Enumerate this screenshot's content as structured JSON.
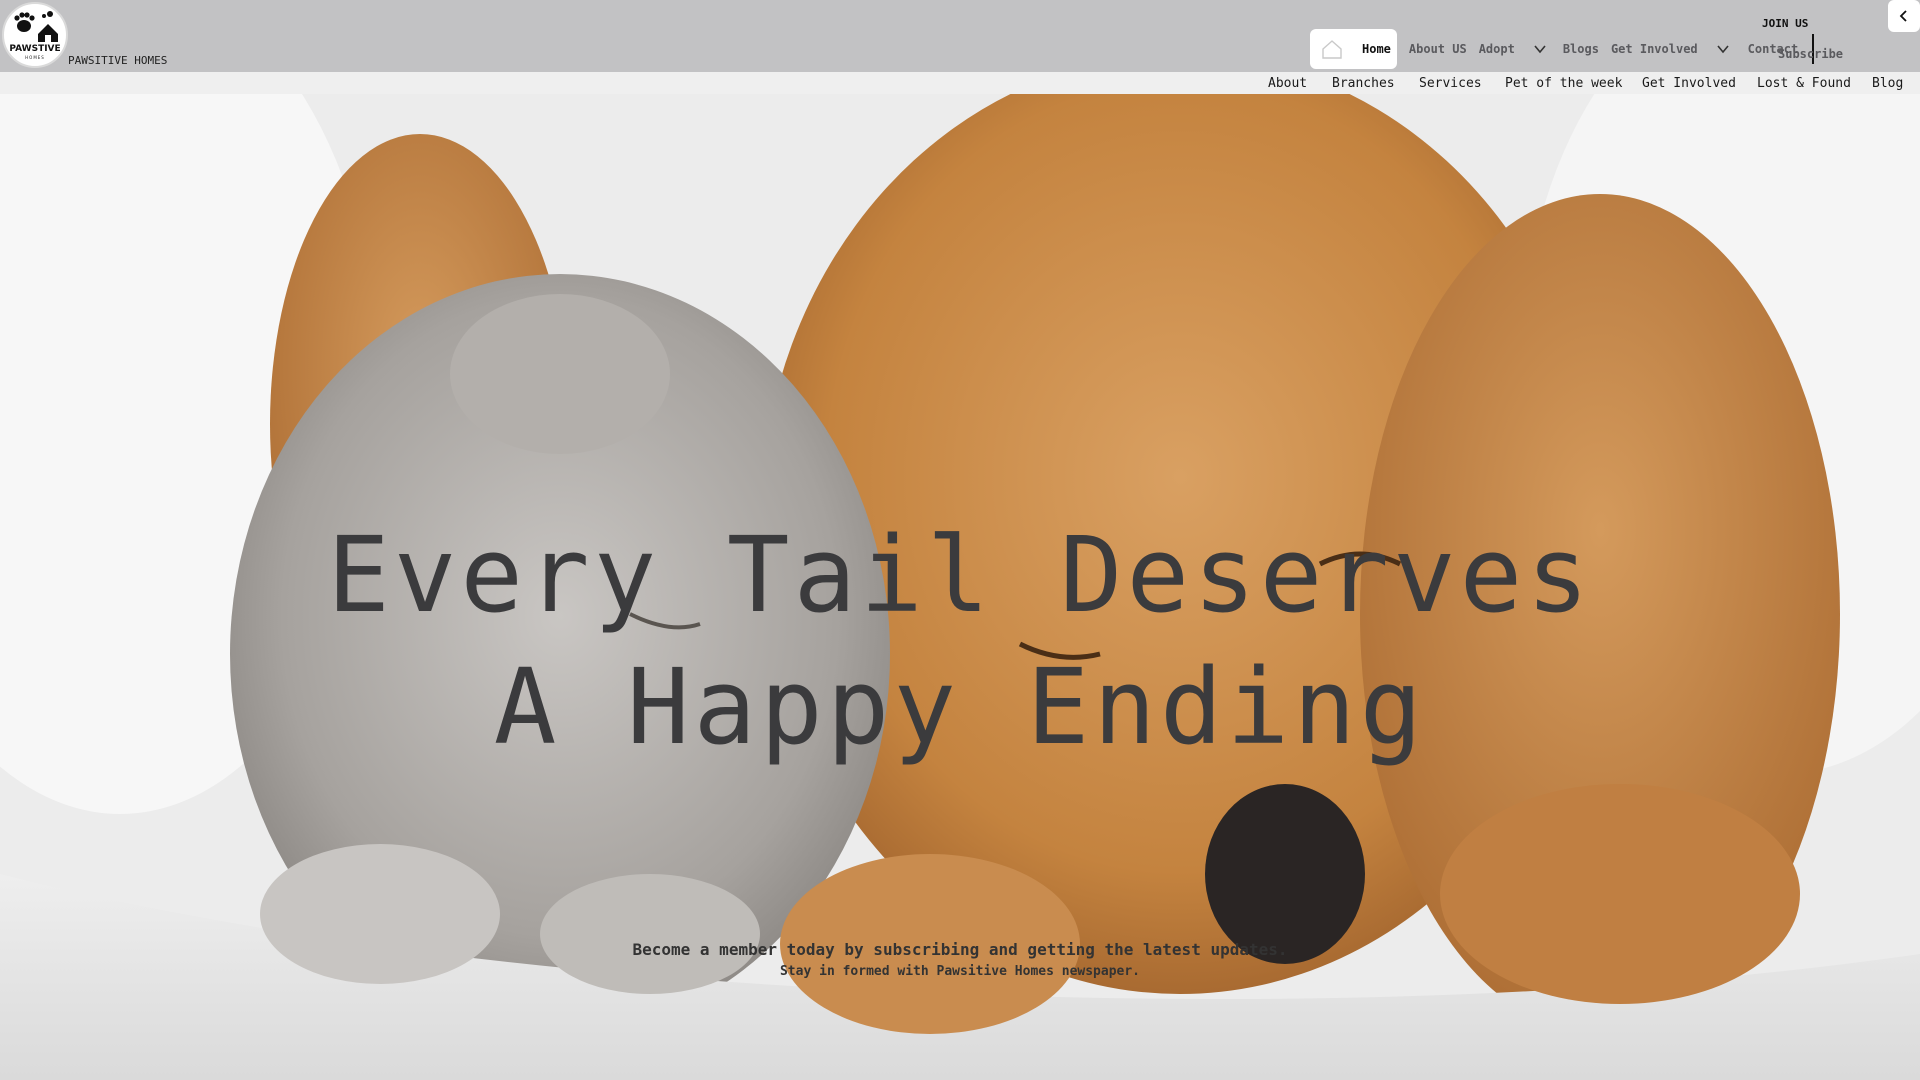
{
  "brand": {
    "logo_text": "PAWSTIVE",
    "logo_subtext": "HOMES",
    "name": "PAWSITIVE HOMES"
  },
  "nav": {
    "home": "Home",
    "about": "About US",
    "adopt": "Adopt",
    "blogs": "Blogs",
    "get_involved": "Get Involved",
    "contact": "Contact",
    "join_us": "JOIN US",
    "subscribe": "Subscribe"
  },
  "subnav": {
    "items": [
      "About",
      "Branches",
      "Services",
      "Pet of the week",
      "Get Involved",
      "Lost & Found",
      "Blog"
    ]
  },
  "hero": {
    "headline_line1": "Every Tail Deserves",
    "headline_line2": "A Happy Ending",
    "subtitle1": "Become a member today by subscribing and getting the latest updates.",
    "subtitle2": "Stay in formed with Pawsitive Homes newspaper."
  },
  "icons": {
    "home": "home-icon",
    "chevron": "chevron-down-icon",
    "collapse": "chevron-left-icon",
    "paw": "paw-icon"
  },
  "colors": {
    "topbar": "#c2c2c4",
    "subnav": "#efefef",
    "headline": "#3b3b3d",
    "dog_fur": "#c8894a",
    "cat_fur": "#a9a6a3"
  }
}
